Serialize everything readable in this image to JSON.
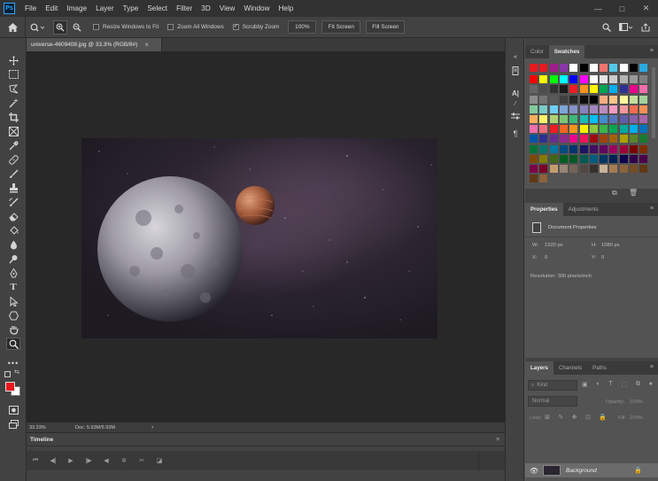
{
  "app": {
    "logo": "Ps"
  },
  "menu": [
    "File",
    "Edit",
    "Image",
    "Layer",
    "Type",
    "Select",
    "Filter",
    "3D",
    "View",
    "Window",
    "Help"
  ],
  "window_controls": {
    "minimize": "—",
    "maximize": "□",
    "close": "✕"
  },
  "options": {
    "resize_windows": "Resize Windows to Fit",
    "zoom_all": "Zoom All Windows",
    "scrubby_zoom": "Scrubby Zoom",
    "zoom_value": "100%",
    "fit_screen": "Fit Screen",
    "fill_screen": "Fill Screen",
    "resize_checked": false,
    "zoom_all_checked": false,
    "scrubby_checked": true
  },
  "document": {
    "tab_title": "universe-4609408.jpg @ 33.3% (RGB/8#)",
    "close": "×"
  },
  "status": {
    "zoom": "33.33%",
    "doc": "Doc: 5.93M/5.93M"
  },
  "timeline": {
    "title": "Timeline"
  },
  "panels": {
    "color_tab": "Color",
    "swatches_tab": "Swatches",
    "properties_tab": "Properties",
    "adjustments_tab": "Adjustments",
    "doc_properties": "Document Properties",
    "w_label": "W:",
    "w_value": "1920 px",
    "h_label": "H:",
    "h_value": "1080 px",
    "x_label": "X:",
    "x_value": "0",
    "y_label": "Y:",
    "y_value": "0",
    "resolution": "Resolution: 300 pixels/inch",
    "layers_tab": "Layers",
    "channels_tab": "Channels",
    "paths_tab": "Paths",
    "kind": "Kind",
    "blend_mode": "Normal",
    "opacity_label": "Opacity:",
    "opacity_value": "100%",
    "lock_label": "Lock:",
    "fill_label": "Fill:",
    "fill_value": "100%",
    "layer_name": "Background"
  },
  "colors": {
    "foreground": "#e8191f",
    "background": "#ffffff",
    "accent": "#31a8ff"
  },
  "swatch_rows": [
    [
      "#e8191f",
      "#e8191f",
      "#a11d8c",
      "#8a35a8",
      "#ffffff",
      "#000000",
      "#ffffff",
      "#f0736e",
      "#52c8e8",
      "#ffffff",
      "#000000",
      "#2aa9e0"
    ],
    [
      "#ff0000",
      "#ffff00",
      "#00ff00",
      "#00ffff",
      "#0000ff",
      "#ff00ff",
      "#ffffff",
      "#e6e6e6",
      "#cccccc",
      "#b3b3b3",
      "#999999",
      "#808080"
    ],
    [
      "#666666",
      "#4d4d4d",
      "#333333",
      "#1a1a1a",
      "#ed1c24",
      "#f7941d",
      "#fff200",
      "#00a651",
      "#00aeef",
      "#2e3192",
      "#ec008c",
      "#f06eaa"
    ],
    [
      "#8c8c8c",
      "#737373",
      "#595959",
      "#404040",
      "#262626",
      "#0d0d0d",
      "#000000",
      "#f9ad81",
      "#fdc68a",
      "#fff799",
      "#c4df9b",
      "#a3d39c"
    ],
    [
      "#82ca9c",
      "#7accc8",
      "#6dcff6",
      "#7da7d9",
      "#8393ca",
      "#8781bd",
      "#a186be",
      "#bd8cbf",
      "#f49ac1",
      "#f5989d",
      "#f26c4f",
      "#f68e56"
    ],
    [
      "#fbaf5d",
      "#fff568",
      "#acd373",
      "#7cc576",
      "#3cb878",
      "#1cbbb4",
      "#00bff3",
      "#448ccb",
      "#5674b9",
      "#605ca8",
      "#855fa8",
      "#a864a8"
    ],
    [
      "#f06ea9",
      "#f26d7d",
      "#ed1c24",
      "#f26522",
      "#f7941d",
      "#fff200",
      "#8dc63f",
      "#39b54a",
      "#00a651",
      "#00a99d",
      "#00aeef",
      "#0072bc"
    ],
    [
      "#0054a6",
      "#2e3192",
      "#662d91",
      "#92278f",
      "#ec008c",
      "#ed145b",
      "#9e0b0f",
      "#a0410d",
      "#a36209",
      "#aba000",
      "#598527",
      "#1a7b30"
    ],
    [
      "#007236",
      "#00746b",
      "#0076a3",
      "#004a80",
      "#003471",
      "#1b1464",
      "#440e62",
      "#630460",
      "#9e005d",
      "#9e0039",
      "#790000",
      "#7b2e00"
    ],
    [
      "#7d4900",
      "#827b00",
      "#406618",
      "#005e20",
      "#005826",
      "#005952",
      "#005b7f",
      "#003663",
      "#002157",
      "#0d004c",
      "#32004b",
      "#4b0049"
    ],
    [
      "#7b0046",
      "#7a0026",
      "#c69c6d",
      "#998675",
      "#736357",
      "#534741",
      "#37302d",
      "#c7b299",
      "#a67c52",
      "#8c6239",
      "#754c24",
      "#603813"
    ],
    [
      "#603913",
      "#8c6239"
    ]
  ]
}
